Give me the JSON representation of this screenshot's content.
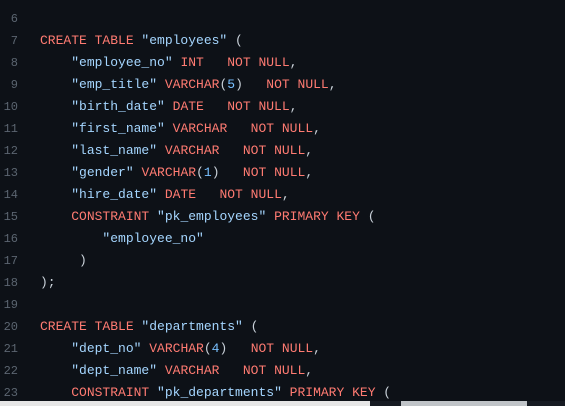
{
  "editor": {
    "lines": [
      {
        "num": "6",
        "tokens": []
      },
      {
        "num": "7",
        "tokens": [
          [
            "kw",
            "CREATE TABLE "
          ],
          [
            "str",
            "\"employees\""
          ],
          [
            "punc",
            " ("
          ]
        ]
      },
      {
        "num": "8",
        "tokens": [
          [
            "punc",
            "    "
          ],
          [
            "str",
            "\"employee_no\""
          ],
          [
            "kw",
            " INT   NOT NULL"
          ],
          [
            "punc",
            ","
          ]
        ]
      },
      {
        "num": "9",
        "tokens": [
          [
            "punc",
            "    "
          ],
          [
            "str",
            "\"emp_title\""
          ],
          [
            "kw",
            " VARCHAR"
          ],
          [
            "punc",
            "("
          ],
          [
            "num",
            "5"
          ],
          [
            "punc",
            ")"
          ],
          [
            "kw",
            "   NOT NULL"
          ],
          [
            "punc",
            ","
          ]
        ]
      },
      {
        "num": "10",
        "tokens": [
          [
            "punc",
            "    "
          ],
          [
            "str",
            "\"birth_date\""
          ],
          [
            "kw",
            " DATE   NOT NULL"
          ],
          [
            "punc",
            ","
          ]
        ]
      },
      {
        "num": "11",
        "tokens": [
          [
            "punc",
            "    "
          ],
          [
            "str",
            "\"first_name\""
          ],
          [
            "kw",
            " VARCHAR   NOT NULL"
          ],
          [
            "punc",
            ","
          ]
        ]
      },
      {
        "num": "12",
        "tokens": [
          [
            "punc",
            "    "
          ],
          [
            "str",
            "\"last_name\""
          ],
          [
            "kw",
            " VARCHAR   NOT NULL"
          ],
          [
            "punc",
            ","
          ]
        ]
      },
      {
        "num": "13",
        "tokens": [
          [
            "punc",
            "    "
          ],
          [
            "str",
            "\"gender\""
          ],
          [
            "kw",
            " VARCHAR"
          ],
          [
            "punc",
            "("
          ],
          [
            "num",
            "1"
          ],
          [
            "punc",
            ")"
          ],
          [
            "kw",
            "   NOT NULL"
          ],
          [
            "punc",
            ","
          ]
        ]
      },
      {
        "num": "14",
        "tokens": [
          [
            "punc",
            "    "
          ],
          [
            "str",
            "\"hire_date\""
          ],
          [
            "kw",
            " DATE   NOT NULL"
          ],
          [
            "punc",
            ","
          ]
        ]
      },
      {
        "num": "15",
        "tokens": [
          [
            "punc",
            "    "
          ],
          [
            "kw",
            "CONSTRAINT "
          ],
          [
            "str",
            "\"pk_employees\""
          ],
          [
            "kw",
            " PRIMARY KEY"
          ],
          [
            "punc",
            " ("
          ]
        ]
      },
      {
        "num": "16",
        "tokens": [
          [
            "punc",
            "        "
          ],
          [
            "str",
            "\"employee_no\""
          ]
        ]
      },
      {
        "num": "17",
        "tokens": [
          [
            "punc",
            "     )"
          ]
        ]
      },
      {
        "num": "18",
        "tokens": [
          [
            "punc",
            ");"
          ]
        ]
      },
      {
        "num": "19",
        "tokens": []
      },
      {
        "num": "20",
        "tokens": [
          [
            "kw",
            "CREATE TABLE "
          ],
          [
            "str",
            "\"departments\""
          ],
          [
            "punc",
            " ("
          ]
        ]
      },
      {
        "num": "21",
        "tokens": [
          [
            "punc",
            "    "
          ],
          [
            "str",
            "\"dept_no\""
          ],
          [
            "kw",
            " VARCHAR"
          ],
          [
            "punc",
            "("
          ],
          [
            "num",
            "4"
          ],
          [
            "punc",
            ")"
          ],
          [
            "kw",
            "   NOT NULL"
          ],
          [
            "punc",
            ","
          ]
        ]
      },
      {
        "num": "22",
        "tokens": [
          [
            "punc",
            "    "
          ],
          [
            "str",
            "\"dept_name\""
          ],
          [
            "kw",
            " VARCHAR   NOT NULL"
          ],
          [
            "punc",
            ","
          ]
        ]
      },
      {
        "num": "23",
        "tokens": [
          [
            "punc",
            "    "
          ],
          [
            "kw",
            "CONSTRAINT "
          ],
          [
            "str",
            "\"pk_departments\""
          ],
          [
            "kw",
            " PRIMARY KEY"
          ],
          [
            "punc",
            " ("
          ]
        ]
      }
    ]
  },
  "colors": {
    "background": "#0d1117",
    "keyword": "#ff7b72",
    "string": "#a5d6ff",
    "number": "#79c0ff",
    "punctuation": "#c9d1d9",
    "line_number": "#5b6570"
  }
}
